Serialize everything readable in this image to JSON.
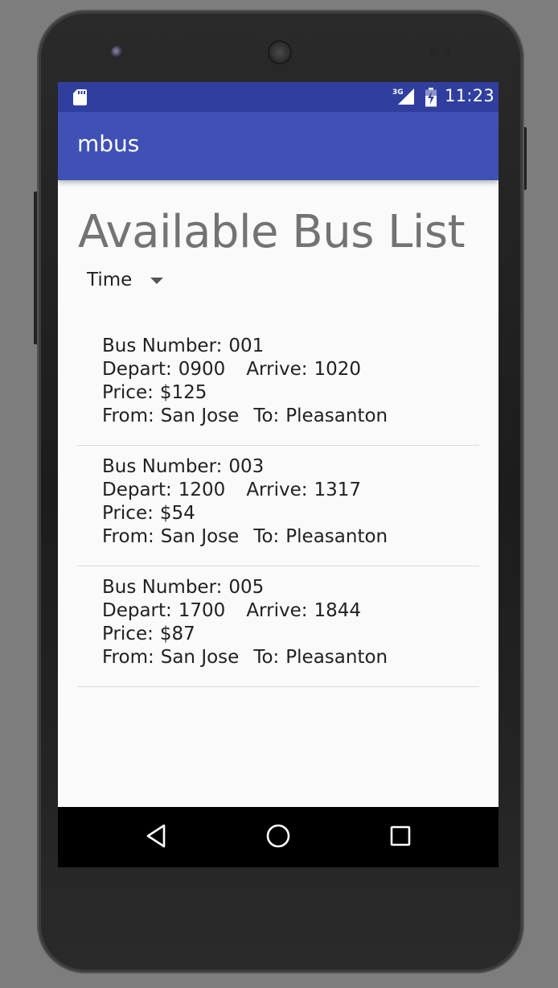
{
  "status_bar": {
    "time": "11:23",
    "network_label": "3G",
    "icons": [
      "sd-card-icon",
      "cellular-signal-icon",
      "battery-charging-icon"
    ]
  },
  "app_bar": {
    "title": "mbus"
  },
  "page": {
    "heading": "Available Bus List",
    "sort_spinner": {
      "selected": "Time"
    }
  },
  "labels": {
    "bus_number": "Bus Number:",
    "depart": "Depart:",
    "arrive": "Arrive:",
    "price": "Price:",
    "from": "From:",
    "to": "To:"
  },
  "buses": [
    {
      "number": "001",
      "depart": "0900",
      "arrive": "1020",
      "price": "$125",
      "from": "San Jose",
      "to": "Pleasanton"
    },
    {
      "number": "003",
      "depart": "1200",
      "arrive": "1317",
      "price": "$54",
      "from": "San Jose",
      "to": "Pleasanton"
    },
    {
      "number": "005",
      "depart": "1700",
      "arrive": "1844",
      "price": "$87",
      "from": "San Jose",
      "to": "Pleasanton"
    }
  ],
  "nav_bar": {
    "icons": [
      "back-icon",
      "home-icon",
      "recents-icon"
    ]
  },
  "colors": {
    "status_bar": "#303f9f",
    "app_bar": "#3f51b5",
    "background": "#fafafa",
    "heading_text": "#737373",
    "body_text": "#212121"
  }
}
